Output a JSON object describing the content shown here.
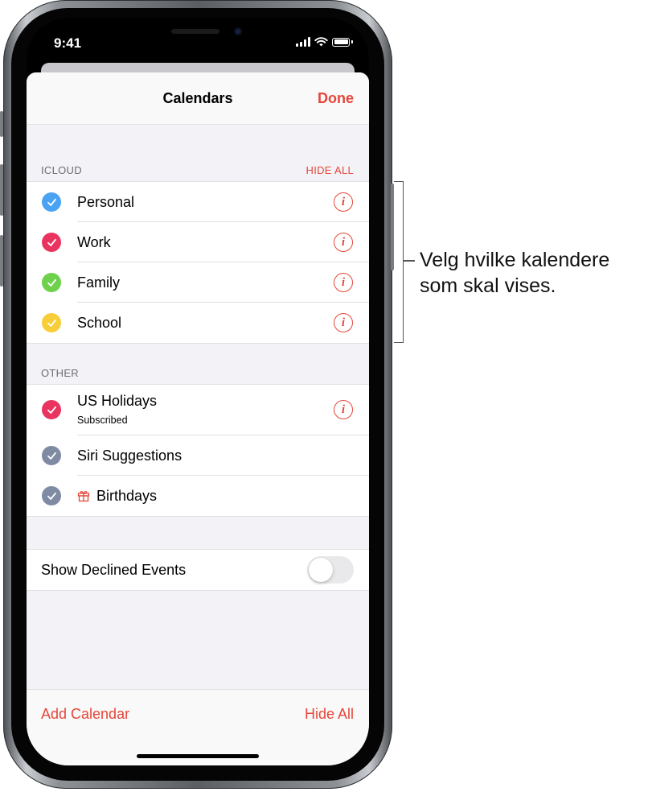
{
  "status_bar": {
    "time": "9:41"
  },
  "nav": {
    "title": "Calendars",
    "done_label": "Done"
  },
  "icloud_section": {
    "header": "ICLOUD",
    "hide_all_label": "HIDE ALL",
    "items": [
      {
        "label": "Personal",
        "color": "#4aa3f2",
        "checked": true
      },
      {
        "label": "Work",
        "color": "#e9345f",
        "checked": true
      },
      {
        "label": "Family",
        "color": "#6dd14c",
        "checked": true
      },
      {
        "label": "School",
        "color": "#f7ce38",
        "checked": true
      }
    ]
  },
  "other_section": {
    "header": "OTHER",
    "items": [
      {
        "label": "US Holidays",
        "sublabel": "Subscribed",
        "color": "#e9345f",
        "checked": true
      },
      {
        "label": "Siri Suggestions",
        "color": "#7f8aa3",
        "checked": true
      },
      {
        "label": "Birthdays",
        "color": "#7f8aa3",
        "checked": true,
        "icon": "gift-icon"
      }
    ]
  },
  "settings": {
    "show_declined_label": "Show Declined Events",
    "show_declined_on": false
  },
  "footer": {
    "add_calendar_label": "Add Calendar",
    "hide_all_label": "Hide All"
  },
  "accent_color": "#e5473a",
  "callout": {
    "text": "Velg hvilke kalendere\nsom skal vises."
  }
}
